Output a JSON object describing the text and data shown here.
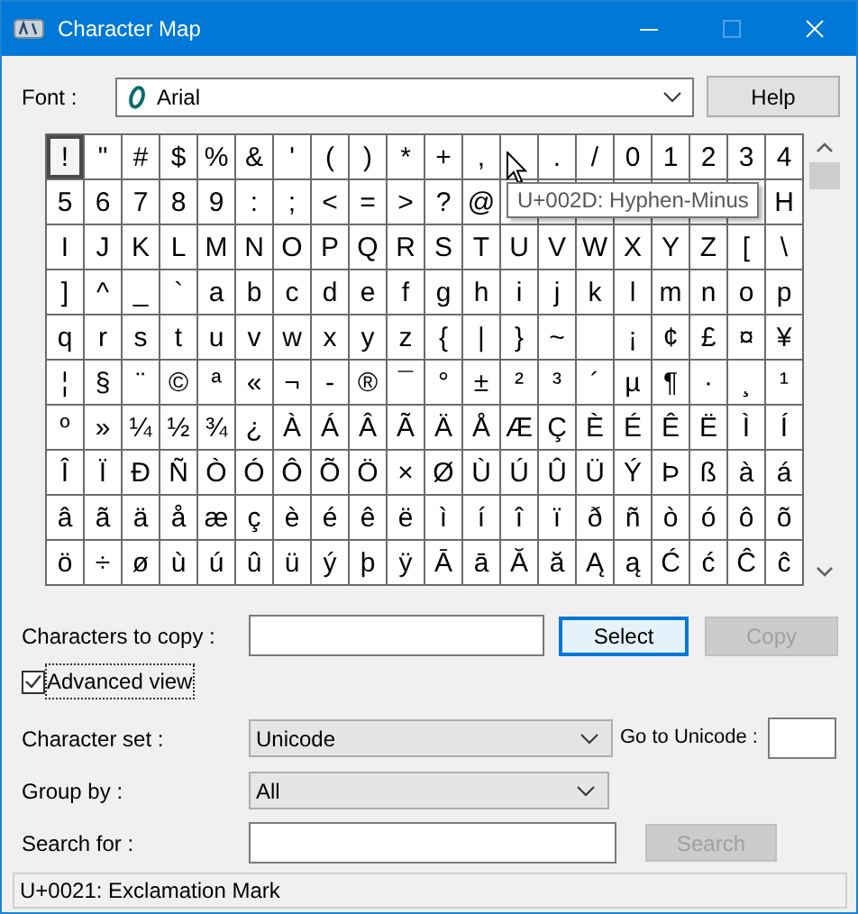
{
  "window": {
    "title": "Character Map",
    "controls": [
      {
        "kind": "minimize",
        "disabled": false
      },
      {
        "kind": "maximize",
        "disabled": true
      },
      {
        "kind": "close",
        "disabled": false
      }
    ]
  },
  "font": {
    "label": "Font :",
    "value": "Arial"
  },
  "help_button": {
    "label": "Help"
  },
  "grid": {
    "rows": [
      [
        {
          "char": "!",
          "selected": true
        },
        {
          "char": "\"",
          "selected": false
        },
        {
          "char": "#",
          "selected": false
        },
        {
          "char": "$",
          "selected": false
        },
        {
          "char": "%",
          "selected": false
        },
        {
          "char": "&",
          "selected": false
        },
        {
          "char": "'",
          "selected": false
        },
        {
          "char": "(",
          "selected": false
        },
        {
          "char": ")",
          "selected": false
        },
        {
          "char": "*",
          "selected": false
        },
        {
          "char": "+",
          "selected": false
        },
        {
          "char": ",",
          "selected": false
        },
        {
          "selected": false
        },
        {
          "char": ".",
          "selected": false
        },
        {
          "char": "/",
          "selected": false
        },
        {
          "char": "0",
          "selected": false
        },
        {
          "char": "1",
          "selected": false
        },
        {
          "char": "2",
          "selected": false
        },
        {
          "char": "3",
          "selected": false
        },
        {
          "char": "4",
          "selected": false
        }
      ],
      [
        {
          "char": "5",
          "selected": false
        },
        {
          "char": "6",
          "selected": false
        },
        {
          "char": "7",
          "selected": false
        },
        {
          "char": "8",
          "selected": false
        },
        {
          "char": "9",
          "selected": false
        },
        {
          "char": ":",
          "selected": false
        },
        {
          "char": ";",
          "selected": false
        },
        {
          "char": "<",
          "selected": false
        },
        {
          "char": "=",
          "selected": false
        },
        {
          "char": ">",
          "selected": false
        },
        {
          "char": "?",
          "selected": false
        },
        {
          "char": "@",
          "selected": false
        },
        {
          "selected": false
        },
        {
          "selected": false
        },
        {
          "selected": false
        },
        {
          "selected": false
        },
        {
          "selected": false
        },
        {
          "selected": false
        },
        {
          "selected": false
        },
        {
          "char": "H",
          "selected": false
        }
      ],
      [
        {
          "char": "I",
          "selected": false
        },
        {
          "char": "J",
          "selected": false
        },
        {
          "char": "K",
          "selected": false
        },
        {
          "char": "L",
          "selected": false
        },
        {
          "char": "M",
          "selected": false
        },
        {
          "char": "N",
          "selected": false
        },
        {
          "char": "O",
          "selected": false
        },
        {
          "char": "P",
          "selected": false
        },
        {
          "char": "Q",
          "selected": false
        },
        {
          "char": "R",
          "selected": false
        },
        {
          "char": "S",
          "selected": false
        },
        {
          "char": "T",
          "selected": false
        },
        {
          "char": "U",
          "selected": false
        },
        {
          "char": "V",
          "selected": false
        },
        {
          "char": "W",
          "selected": false
        },
        {
          "char": "X",
          "selected": false
        },
        {
          "char": "Y",
          "selected": false
        },
        {
          "char": "Z",
          "selected": false
        },
        {
          "char": "[",
          "selected": false
        },
        {
          "char": "\\",
          "selected": false
        }
      ],
      [
        {
          "char": "]",
          "selected": false
        },
        {
          "char": "^",
          "selected": false
        },
        {
          "char": "_",
          "selected": false
        },
        {
          "char": "`",
          "selected": false
        },
        {
          "char": "a",
          "selected": false
        },
        {
          "char": "b",
          "selected": false
        },
        {
          "char": "c",
          "selected": false
        },
        {
          "char": "d",
          "selected": false
        },
        {
          "char": "e",
          "selected": false
        },
        {
          "char": "f",
          "selected": false
        },
        {
          "char": "g",
          "selected": false
        },
        {
          "char": "h",
          "selected": false
        },
        {
          "char": "i",
          "selected": false
        },
        {
          "char": "j",
          "selected": false
        },
        {
          "char": "k",
          "selected": false
        },
        {
          "char": "l",
          "selected": false
        },
        {
          "char": "m",
          "selected": false
        },
        {
          "char": "n",
          "selected": false
        },
        {
          "char": "o",
          "selected": false
        },
        {
          "char": "p",
          "selected": false
        }
      ],
      [
        {
          "char": "q",
          "selected": false
        },
        {
          "char": "r",
          "selected": false
        },
        {
          "char": "s",
          "selected": false
        },
        {
          "char": "t",
          "selected": false
        },
        {
          "char": "u",
          "selected": false
        },
        {
          "char": "v",
          "selected": false
        },
        {
          "char": "w",
          "selected": false
        },
        {
          "char": "x",
          "selected": false
        },
        {
          "char": "y",
          "selected": false
        },
        {
          "char": "z",
          "selected": false
        },
        {
          "char": "{",
          "selected": false
        },
        {
          "char": "|",
          "selected": false
        },
        {
          "char": "}",
          "selected": false
        },
        {
          "char": "~",
          "selected": false
        },
        {
          "selected": false
        },
        {
          "char": "¡",
          "selected": false
        },
        {
          "char": "¢",
          "selected": false
        },
        {
          "char": "£",
          "selected": false
        },
        {
          "char": "¤",
          "selected": false
        },
        {
          "char": "¥",
          "selected": false
        }
      ],
      [
        {
          "char": "¦",
          "selected": false
        },
        {
          "char": "§",
          "selected": false
        },
        {
          "char": "¨",
          "selected": false
        },
        {
          "char": "©",
          "selected": false
        },
        {
          "char": "ª",
          "selected": false
        },
        {
          "char": "«",
          "selected": false
        },
        {
          "char": "¬",
          "selected": false
        },
        {
          "char": "-",
          "selected": false
        },
        {
          "char": "®",
          "selected": false
        },
        {
          "char": "¯",
          "selected": false
        },
        {
          "char": "°",
          "selected": false
        },
        {
          "char": "±",
          "selected": false
        },
        {
          "char": "²",
          "selected": false
        },
        {
          "char": "³",
          "selected": false
        },
        {
          "char": "´",
          "selected": false
        },
        {
          "char": "µ",
          "selected": false
        },
        {
          "char": "¶",
          "selected": false
        },
        {
          "char": "·",
          "selected": false
        },
        {
          "char": "¸",
          "selected": false
        },
        {
          "char": "¹",
          "selected": false
        }
      ],
      [
        {
          "char": "º",
          "selected": false
        },
        {
          "char": "»",
          "selected": false
        },
        {
          "char": "¼",
          "selected": false
        },
        {
          "char": "½",
          "selected": false
        },
        {
          "char": "¾",
          "selected": false
        },
        {
          "char": "¿",
          "selected": false
        },
        {
          "char": "À",
          "selected": false
        },
        {
          "char": "Á",
          "selected": false
        },
        {
          "char": "Â",
          "selected": false
        },
        {
          "char": "Ã",
          "selected": false
        },
        {
          "char": "Ä",
          "selected": false
        },
        {
          "char": "Å",
          "selected": false
        },
        {
          "char": "Æ",
          "selected": false
        },
        {
          "char": "Ç",
          "selected": false
        },
        {
          "char": "È",
          "selected": false
        },
        {
          "char": "É",
          "selected": false
        },
        {
          "char": "Ê",
          "selected": false
        },
        {
          "char": "Ë",
          "selected": false
        },
        {
          "char": "Ì",
          "selected": false
        },
        {
          "char": "Í",
          "selected": false
        }
      ],
      [
        {
          "char": "Î",
          "selected": false
        },
        {
          "char": "Ï",
          "selected": false
        },
        {
          "char": "Ð",
          "selected": false
        },
        {
          "char": "Ñ",
          "selected": false
        },
        {
          "char": "Ò",
          "selected": false
        },
        {
          "char": "Ó",
          "selected": false
        },
        {
          "char": "Ô",
          "selected": false
        },
        {
          "char": "Õ",
          "selected": false
        },
        {
          "char": "Ö",
          "selected": false
        },
        {
          "char": "×",
          "selected": false
        },
        {
          "char": "Ø",
          "selected": false
        },
        {
          "char": "Ù",
          "selected": false
        },
        {
          "char": "Ú",
          "selected": false
        },
        {
          "char": "Û",
          "selected": false
        },
        {
          "char": "Ü",
          "selected": false
        },
        {
          "char": "Ý",
          "selected": false
        },
        {
          "char": "Þ",
          "selected": false
        },
        {
          "char": "ß",
          "selected": false
        },
        {
          "char": "à",
          "selected": false
        },
        {
          "char": "á",
          "selected": false
        }
      ],
      [
        {
          "char": "â",
          "selected": false
        },
        {
          "char": "ã",
          "selected": false
        },
        {
          "char": "ä",
          "selected": false
        },
        {
          "char": "å",
          "selected": false
        },
        {
          "char": "æ",
          "selected": false
        },
        {
          "char": "ç",
          "selected": false
        },
        {
          "char": "è",
          "selected": false
        },
        {
          "char": "é",
          "selected": false
        },
        {
          "char": "ê",
          "selected": false
        },
        {
          "char": "ë",
          "selected": false
        },
        {
          "char": "ì",
          "selected": false
        },
        {
          "char": "í",
          "selected": false
        },
        {
          "char": "î",
          "selected": false
        },
        {
          "char": "ï",
          "selected": false
        },
        {
          "char": "ð",
          "selected": false
        },
        {
          "char": "ñ",
          "selected": false
        },
        {
          "char": "ò",
          "selected": false
        },
        {
          "char": "ó",
          "selected": false
        },
        {
          "char": "ô",
          "selected": false
        },
        {
          "char": "õ",
          "selected": false
        }
      ],
      [
        {
          "char": "ö",
          "selected": false
        },
        {
          "char": "÷",
          "selected": false
        },
        {
          "char": "ø",
          "selected": false
        },
        {
          "char": "ù",
          "selected": false
        },
        {
          "char": "ú",
          "selected": false
        },
        {
          "char": "û",
          "selected": false
        },
        {
          "char": "ü",
          "selected": false
        },
        {
          "char": "ý",
          "selected": false
        },
        {
          "char": "þ",
          "selected": false
        },
        {
          "char": "ÿ",
          "selected": false
        },
        {
          "char": "Ā",
          "selected": false
        },
        {
          "char": "ā",
          "selected": false
        },
        {
          "char": "Ă",
          "selected": false
        },
        {
          "char": "ă",
          "selected": false
        },
        {
          "char": "Ą",
          "selected": false
        },
        {
          "char": "ą",
          "selected": false
        },
        {
          "char": "Ć",
          "selected": false
        },
        {
          "char": "ć",
          "selected": false
        },
        {
          "char": "Ĉ",
          "selected": false
        },
        {
          "char": "ĉ",
          "selected": false
        }
      ]
    ]
  },
  "tooltip": "U+002D: Hyphen-Minus",
  "characters_to_copy": {
    "label": "Characters to copy :"
  },
  "select_button": {
    "label": "Select",
    "default": true
  },
  "copy_button": {
    "label": "Copy",
    "disabled": true
  },
  "advanced_view": {
    "label": "Advanced view",
    "checked": true
  },
  "character_set": {
    "label": "Character set :",
    "value": "Unicode"
  },
  "go_to_unicode": {
    "label": "Go to Unicode :"
  },
  "group_by": {
    "label": "Group by :",
    "value": "All"
  },
  "search_for": {
    "label": "Search for :"
  },
  "search_button": {
    "label": "Search",
    "disabled": true
  },
  "status_bar": "U+0021: Exclamation Mark"
}
